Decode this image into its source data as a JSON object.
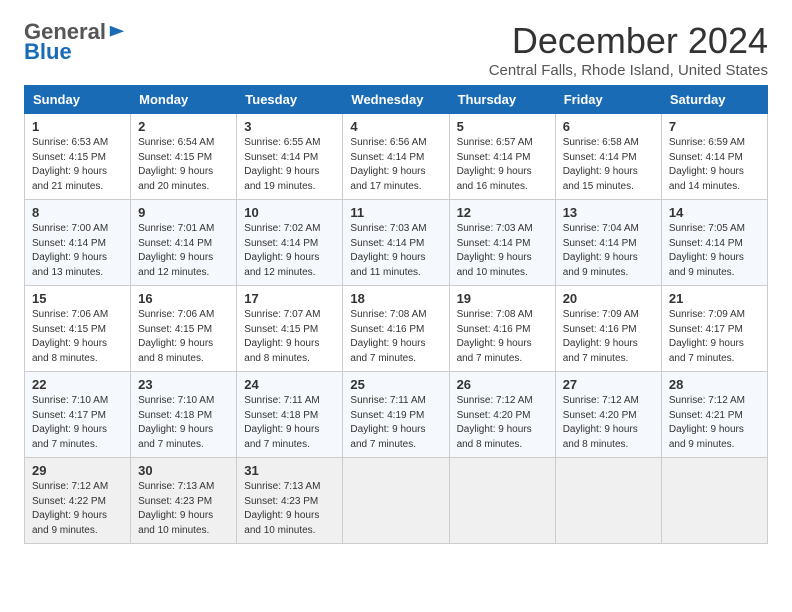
{
  "header": {
    "logo_general": "General",
    "logo_blue": "Blue",
    "month_title": "December 2024",
    "location": "Central Falls, Rhode Island, United States"
  },
  "weekdays": [
    "Sunday",
    "Monday",
    "Tuesday",
    "Wednesday",
    "Thursday",
    "Friday",
    "Saturday"
  ],
  "weeks": [
    [
      {
        "day": "1",
        "lines": [
          "Sunrise: 6:53 AM",
          "Sunset: 4:15 PM",
          "Daylight: 9 hours",
          "and 21 minutes."
        ]
      },
      {
        "day": "2",
        "lines": [
          "Sunrise: 6:54 AM",
          "Sunset: 4:15 PM",
          "Daylight: 9 hours",
          "and 20 minutes."
        ]
      },
      {
        "day": "3",
        "lines": [
          "Sunrise: 6:55 AM",
          "Sunset: 4:14 PM",
          "Daylight: 9 hours",
          "and 19 minutes."
        ]
      },
      {
        "day": "4",
        "lines": [
          "Sunrise: 6:56 AM",
          "Sunset: 4:14 PM",
          "Daylight: 9 hours",
          "and 17 minutes."
        ]
      },
      {
        "day": "5",
        "lines": [
          "Sunrise: 6:57 AM",
          "Sunset: 4:14 PM",
          "Daylight: 9 hours",
          "and 16 minutes."
        ]
      },
      {
        "day": "6",
        "lines": [
          "Sunrise: 6:58 AM",
          "Sunset: 4:14 PM",
          "Daylight: 9 hours",
          "and 15 minutes."
        ]
      },
      {
        "day": "7",
        "lines": [
          "Sunrise: 6:59 AM",
          "Sunset: 4:14 PM",
          "Daylight: 9 hours",
          "and 14 minutes."
        ]
      }
    ],
    [
      {
        "day": "8",
        "lines": [
          "Sunrise: 7:00 AM",
          "Sunset: 4:14 PM",
          "Daylight: 9 hours",
          "and 13 minutes."
        ]
      },
      {
        "day": "9",
        "lines": [
          "Sunrise: 7:01 AM",
          "Sunset: 4:14 PM",
          "Daylight: 9 hours",
          "and 12 minutes."
        ]
      },
      {
        "day": "10",
        "lines": [
          "Sunrise: 7:02 AM",
          "Sunset: 4:14 PM",
          "Daylight: 9 hours",
          "and 12 minutes."
        ]
      },
      {
        "day": "11",
        "lines": [
          "Sunrise: 7:03 AM",
          "Sunset: 4:14 PM",
          "Daylight: 9 hours",
          "and 11 minutes."
        ]
      },
      {
        "day": "12",
        "lines": [
          "Sunrise: 7:03 AM",
          "Sunset: 4:14 PM",
          "Daylight: 9 hours",
          "and 10 minutes."
        ]
      },
      {
        "day": "13",
        "lines": [
          "Sunrise: 7:04 AM",
          "Sunset: 4:14 PM",
          "Daylight: 9 hours",
          "and 9 minutes."
        ]
      },
      {
        "day": "14",
        "lines": [
          "Sunrise: 7:05 AM",
          "Sunset: 4:14 PM",
          "Daylight: 9 hours",
          "and 9 minutes."
        ]
      }
    ],
    [
      {
        "day": "15",
        "lines": [
          "Sunrise: 7:06 AM",
          "Sunset: 4:15 PM",
          "Daylight: 9 hours",
          "and 8 minutes."
        ]
      },
      {
        "day": "16",
        "lines": [
          "Sunrise: 7:06 AM",
          "Sunset: 4:15 PM",
          "Daylight: 9 hours",
          "and 8 minutes."
        ]
      },
      {
        "day": "17",
        "lines": [
          "Sunrise: 7:07 AM",
          "Sunset: 4:15 PM",
          "Daylight: 9 hours",
          "and 8 minutes."
        ]
      },
      {
        "day": "18",
        "lines": [
          "Sunrise: 7:08 AM",
          "Sunset: 4:16 PM",
          "Daylight: 9 hours",
          "and 7 minutes."
        ]
      },
      {
        "day": "19",
        "lines": [
          "Sunrise: 7:08 AM",
          "Sunset: 4:16 PM",
          "Daylight: 9 hours",
          "and 7 minutes."
        ]
      },
      {
        "day": "20",
        "lines": [
          "Sunrise: 7:09 AM",
          "Sunset: 4:16 PM",
          "Daylight: 9 hours",
          "and 7 minutes."
        ]
      },
      {
        "day": "21",
        "lines": [
          "Sunrise: 7:09 AM",
          "Sunset: 4:17 PM",
          "Daylight: 9 hours",
          "and 7 minutes."
        ]
      }
    ],
    [
      {
        "day": "22",
        "lines": [
          "Sunrise: 7:10 AM",
          "Sunset: 4:17 PM",
          "Daylight: 9 hours",
          "and 7 minutes."
        ]
      },
      {
        "day": "23",
        "lines": [
          "Sunrise: 7:10 AM",
          "Sunset: 4:18 PM",
          "Daylight: 9 hours",
          "and 7 minutes."
        ]
      },
      {
        "day": "24",
        "lines": [
          "Sunrise: 7:11 AM",
          "Sunset: 4:18 PM",
          "Daylight: 9 hours",
          "and 7 minutes."
        ]
      },
      {
        "day": "25",
        "lines": [
          "Sunrise: 7:11 AM",
          "Sunset: 4:19 PM",
          "Daylight: 9 hours",
          "and 7 minutes."
        ]
      },
      {
        "day": "26",
        "lines": [
          "Sunrise: 7:12 AM",
          "Sunset: 4:20 PM",
          "Daylight: 9 hours",
          "and 8 minutes."
        ]
      },
      {
        "day": "27",
        "lines": [
          "Sunrise: 7:12 AM",
          "Sunset: 4:20 PM",
          "Daylight: 9 hours",
          "and 8 minutes."
        ]
      },
      {
        "day": "28",
        "lines": [
          "Sunrise: 7:12 AM",
          "Sunset: 4:21 PM",
          "Daylight: 9 hours",
          "and 9 minutes."
        ]
      }
    ],
    [
      {
        "day": "29",
        "lines": [
          "Sunrise: 7:12 AM",
          "Sunset: 4:22 PM",
          "Daylight: 9 hours",
          "and 9 minutes."
        ]
      },
      {
        "day": "30",
        "lines": [
          "Sunrise: 7:13 AM",
          "Sunset: 4:23 PM",
          "Daylight: 9 hours",
          "and 10 minutes."
        ]
      },
      {
        "day": "31",
        "lines": [
          "Sunrise: 7:13 AM",
          "Sunset: 4:23 PM",
          "Daylight: 9 hours",
          "and 10 minutes."
        ]
      },
      null,
      null,
      null,
      null
    ]
  ]
}
